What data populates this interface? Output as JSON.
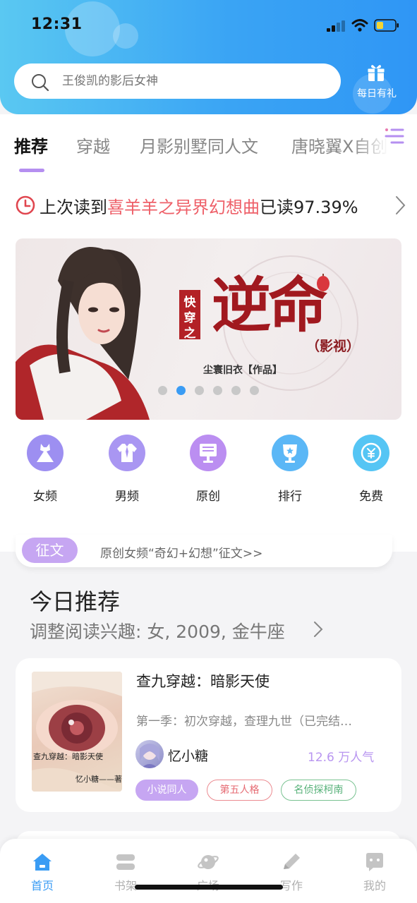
{
  "status_bar": {
    "time": "12:31"
  },
  "search": {
    "placeholder": "王俊凯的影后女神"
  },
  "gift": {
    "label": "每日有礼"
  },
  "tabs": [
    "推荐",
    "穿越",
    "月影别墅同人文",
    "唐晓翼X自创"
  ],
  "last_read": {
    "prefix": "上次读到",
    "book": "喜羊羊之异界幻想曲",
    "status": "已读",
    "percent": "97.39%"
  },
  "banner": {
    "title_small": "快穿之",
    "title_big": "逆命",
    "subtitle": "（影视）",
    "author": "尘寰旧衣【作品】",
    "page_count": 6,
    "active_page": 1
  },
  "quick_nav": [
    {
      "label": "女频",
      "icon": "dress-icon",
      "color": "#9b8cf0"
    },
    {
      "label": "男频",
      "icon": "shirt-icon",
      "color": "#9b8cf0"
    },
    {
      "label": "原创",
      "icon": "book-stand-icon",
      "color": "#b98df0"
    },
    {
      "label": "排行",
      "icon": "trophy-icon",
      "color": "#5cb6f6"
    },
    {
      "label": "免费",
      "icon": "coin-icon",
      "color": "#56c4f4"
    }
  ],
  "notice": {
    "badge": "征文",
    "text": "原创女频“奇幻+幻想”征文>>"
  },
  "recommend": {
    "title": "今日推荐",
    "subtitle": "调整阅读兴趣: 女, 2009, 金牛座",
    "book": {
      "title": "查九穿越：暗影天使",
      "description": "第一季：初次穿越，查理九世（已完结…",
      "author": "忆小糖",
      "popularity": "12.6 万人气",
      "tags": [
        "小说同人",
        "第五人格",
        "名侦探柯南"
      ],
      "cover_title": "查九穿越：暗影天使",
      "cover_author": "忆小糖——著"
    }
  },
  "bottom_nav": [
    {
      "label": "首页",
      "icon": "home-icon",
      "active": true
    },
    {
      "label": "书架",
      "icon": "bookshelf-icon",
      "active": false
    },
    {
      "label": "广场",
      "icon": "planet-icon",
      "active": false
    },
    {
      "label": "写作",
      "icon": "pen-icon",
      "active": false
    },
    {
      "label": "我的",
      "icon": "chat-bubble-icon",
      "active": false
    }
  ],
  "colors": {
    "accent": "#3a9cf4",
    "purple": "#c6a6f2",
    "red": "#ee5f68"
  }
}
